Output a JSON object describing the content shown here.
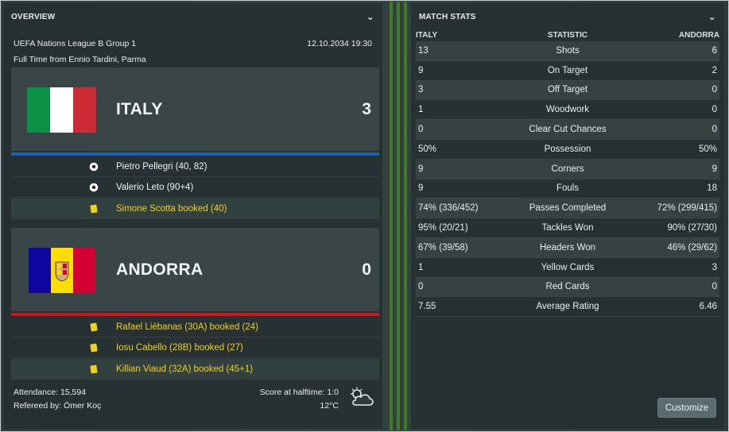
{
  "overview": {
    "header": "OVERVIEW",
    "competition": "UEFA Nations League B Group 1",
    "datetime": "12.10.2034 19:30",
    "result_line": "Full Time from Ennio Tardini, Parma",
    "home": {
      "name": "ITALY",
      "score": "3",
      "bar_color": "#1f5fb0",
      "events": [
        {
          "type": "goal",
          "text": "Pietro Pellegri (40, 82)"
        },
        {
          "type": "goal",
          "text": "Valerio Leto (90+4)"
        },
        {
          "type": "yellow",
          "text": "Simone Scotta booked (40)"
        }
      ]
    },
    "away": {
      "name": "ANDORRA",
      "score": "0",
      "bar_color": "#d0151c",
      "events": [
        {
          "type": "yellow",
          "text": "Rafael Liébanas (30A) booked (24)"
        },
        {
          "type": "yellow",
          "text": "Iosu Cabello (28B) booked (27)"
        },
        {
          "type": "yellow",
          "text": "Killian Viaud (32A) booked (45+1)"
        }
      ]
    },
    "attendance": "Attendance: 15,594",
    "referee": "Refereed by: Ömer Koç",
    "halftime": "Score at halftime: 1:0",
    "temperature": "12°C",
    "weather_icon": "partly-cloudy-icon"
  },
  "stats": {
    "header": "MATCH STATS",
    "col_home": "ITALY",
    "col_stat": "STATISTIC",
    "col_away": "ANDORRA",
    "rows": [
      {
        "home": "13",
        "stat": "Shots",
        "away": "6"
      },
      {
        "home": "9",
        "stat": "On Target",
        "away": "2"
      },
      {
        "home": "3",
        "stat": "Off Target",
        "away": "0"
      },
      {
        "home": "1",
        "stat": "Woodwork",
        "away": "0"
      },
      {
        "home": "0",
        "stat": "Clear Cut Chances",
        "away": "0"
      },
      {
        "home": "50%",
        "stat": "Possession",
        "away": "50%"
      },
      {
        "home": "9",
        "stat": "Corners",
        "away": "9"
      },
      {
        "home": "9",
        "stat": "Fouls",
        "away": "18"
      },
      {
        "home": "74% (336/452)",
        "stat": "Passes Completed",
        "away": "72% (299/415)"
      },
      {
        "home": "95% (20/21)",
        "stat": "Tackles Won",
        "away": "90% (27/30)"
      },
      {
        "home": "67% (39/58)",
        "stat": "Headers Won",
        "away": "46% (29/62)"
      },
      {
        "home": "1",
        "stat": "Yellow Cards",
        "away": "3"
      },
      {
        "home": "0",
        "stat": "Red Cards",
        "away": "0"
      },
      {
        "home": "7.55",
        "stat": "Average Rating",
        "away": "6.46"
      }
    ],
    "customize_label": "Customize"
  },
  "colors": {
    "italy_green": "#0a9246",
    "italy_white": "#ffffff",
    "italy_red": "#ce2b37",
    "andorra_blue": "#10069f",
    "andorra_yellow": "#fedd00",
    "andorra_red": "#d50032",
    "card_yellow": "#f2d219"
  }
}
